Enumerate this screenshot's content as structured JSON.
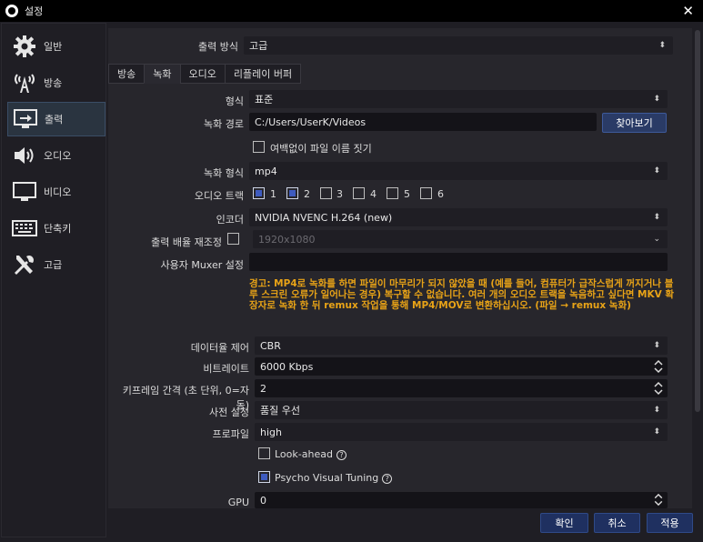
{
  "window": {
    "title": "설정",
    "close_glyph": "✕"
  },
  "sidebar": {
    "items": [
      {
        "label": "일반",
        "icon": "gear-icon"
      },
      {
        "label": "방송",
        "icon": "broadcast-icon"
      },
      {
        "label": "출력",
        "icon": "output-icon",
        "active": true
      },
      {
        "label": "오디오",
        "icon": "speaker-icon"
      },
      {
        "label": "비디오",
        "icon": "monitor-icon"
      },
      {
        "label": "단축키",
        "icon": "keyboard-icon"
      },
      {
        "label": "고급",
        "icon": "tools-icon"
      }
    ]
  },
  "output_mode": {
    "label": "출력 방식",
    "value": "고급"
  },
  "tabs": [
    "방송",
    "녹화",
    "오디오",
    "리플레이 버퍼"
  ],
  "recording": {
    "type": {
      "label": "형식",
      "value": "표준"
    },
    "path": {
      "label": "녹화 경로",
      "value": "C:/Users/UserK/Videos",
      "browse": "찾아보기"
    },
    "no_space": {
      "label": "여백없이 파일 이름 짓기"
    },
    "format": {
      "label": "녹화 형식",
      "value": "mp4"
    },
    "tracks": {
      "label": "오디오 트랙",
      "items": [
        "1",
        "2",
        "3",
        "4",
        "5",
        "6"
      ]
    },
    "encoder": {
      "label": "인코더",
      "value": "NVIDIA NVENC H.264 (new)"
    },
    "rescale": {
      "label": "출력 배율 재조정",
      "value": "1920x1080"
    },
    "muxer": {
      "label": "사용자 Muxer 설정",
      "value": ""
    },
    "warning": "경고: MP4로 녹화를 하면 파일이 마무리가 되지 않았을 때 (예를 들어, 컴퓨터가 급작스럽게 꺼지거나 블루 스크린 오류가 일어나는 경우) 복구할 수 없습니다. 여러 개의 오디오 트랙을 녹음하고 싶다면 MKV 확장자로 녹화 한 뒤 remux 작업을 통해 MP4/MOV로 변환하십시오. (파일 → remux 녹화)"
  },
  "encoder_settings": {
    "rate_control": {
      "label": "데이터율 제어",
      "value": "CBR"
    },
    "bitrate": {
      "label": "비트레이트",
      "value": "6000 Kbps"
    },
    "keyframe": {
      "label": "키프레임 간격 (초 단위, 0=자동)",
      "value": "2"
    },
    "preset": {
      "label": "사전 설정",
      "value": "품질 우선"
    },
    "profile": {
      "label": "프로파일",
      "value": "high"
    },
    "lookahead": {
      "label": "Look-ahead"
    },
    "psycho": {
      "label": "Psycho Visual Tuning"
    },
    "gpu": {
      "label": "GPU",
      "value": "0"
    }
  },
  "buttons": {
    "ok": "확인",
    "cancel": "취소",
    "apply": "적용"
  },
  "colors": {
    "accent": "#3e5bbf",
    "warning": "#e8a317",
    "button": "#2a3b66"
  }
}
